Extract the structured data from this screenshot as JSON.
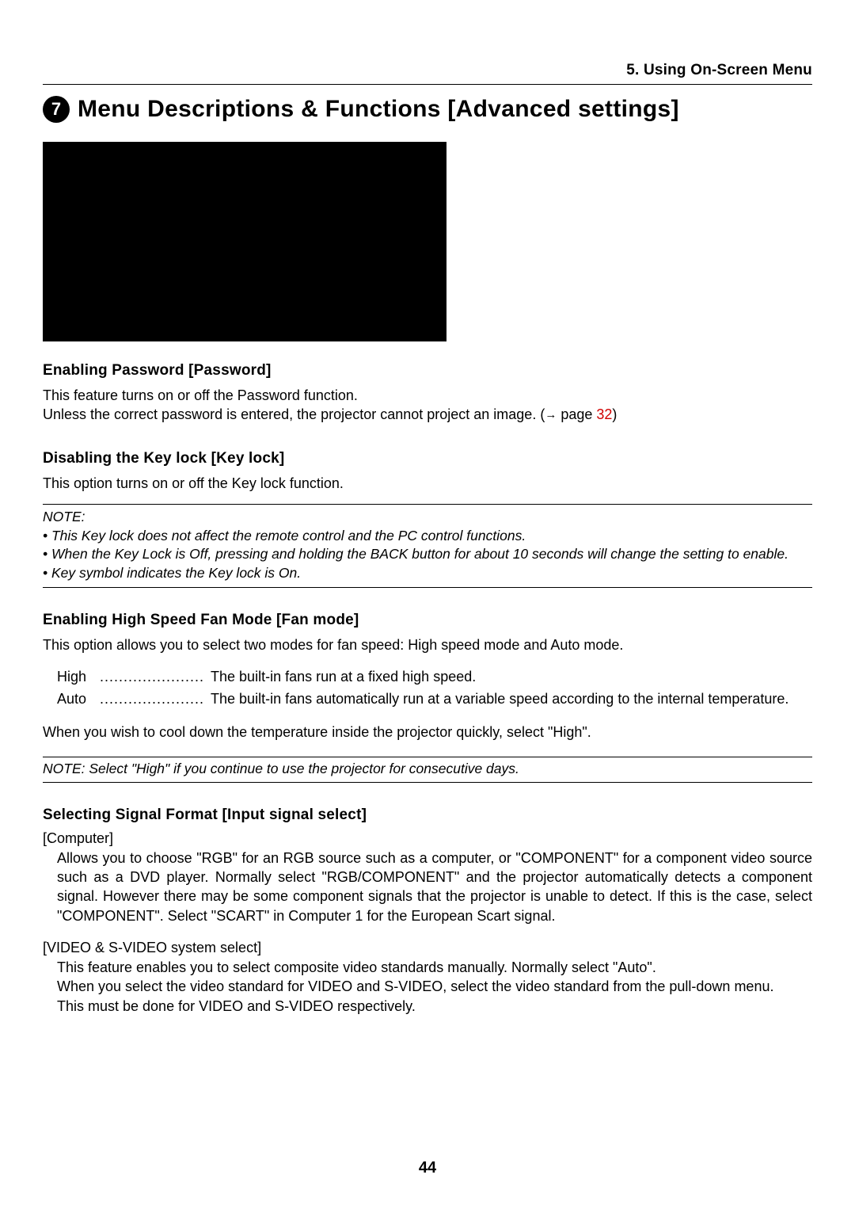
{
  "chapter_header": "5. Using On-Screen Menu",
  "section_number": "7",
  "main_title": "Menu Descriptions & Functions [Advanced settings]",
  "password": {
    "heading": "Enabling Password [Password]",
    "line1": "This feature turns on or off the Password function.",
    "line2_a": "Unless the correct password is entered, the projector cannot project an image. (",
    "line2_arrow": "→",
    "line2_b": " page ",
    "line2_ref": "32",
    "line2_c": ")"
  },
  "keylock": {
    "heading": "Disabling the Key lock [Key lock]",
    "body": "This option turns on or off the Key lock function.",
    "note_label": "NOTE:",
    "note1": "•  This Key lock does not affect the remote control and the PC control functions.",
    "note2": "•  When the Key Lock is Off, pressing and holding the BACK button for about 10 seconds will change the setting to enable.",
    "note3": "•  Key symbol      indicates the Key lock is On."
  },
  "fan": {
    "heading": "Enabling High Speed Fan Mode [Fan mode]",
    "body": "This option allows you to select two modes for fan speed: High speed mode and Auto mode.",
    "row1_label": "High",
    "row1_dots": "......................",
    "row1_desc": "The built-in fans run at a fixed high speed.",
    "row2_label": "Auto",
    "row2_dots": "......................",
    "row2_desc": "The built-in fans automatically run at a variable speed according to the internal temperature.",
    "after": "When you wish to cool down the temperature inside the projector quickly, select \"High\".",
    "note": "NOTE: Select \"High\" if you continue to use the projector for consecutive days."
  },
  "signal": {
    "heading": "Selecting Signal Format [Input signal select]",
    "sub1_label": "[Computer]",
    "sub1_body": "Allows you to choose \"RGB\" for an RGB source such as a computer, or \"COMPONENT\" for a component video source such as a DVD player. Normally select \"RGB/COMPONENT\" and the projector automatically detects a component signal. However there may be some component signals that the projector is unable to detect. If this is the case, select \"COMPONENT\". Select \"SCART\" in Computer 1 for the European Scart signal.",
    "sub2_label": "[VIDEO & S-VIDEO system select]",
    "sub2_line1": "This feature enables you to select composite video standards manually. Normally select \"Auto\".",
    "sub2_line2": "When you select the video standard for VIDEO and S-VIDEO, select the video standard from the pull-down menu.",
    "sub2_line3": "This must be done for VIDEO and S-VIDEO respectively."
  },
  "page_number": "44"
}
